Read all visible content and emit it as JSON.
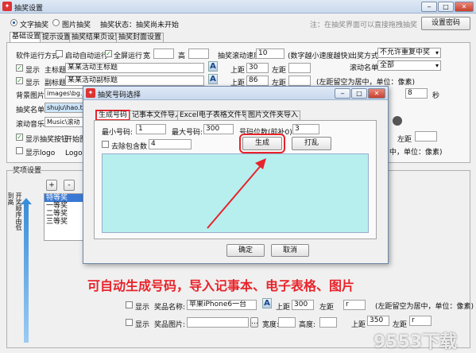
{
  "main": {
    "title": "抽奖设置",
    "mode_text": "文字抽奖",
    "mode_image": "图片抽奖",
    "status_label": "抽奖状态：",
    "status_value": "抽奖尚未开始",
    "hint": "注：在抽奖界面可以直接拖拽抽奖",
    "set_password": "设置密码",
    "tabs": [
      "基础设置",
      "提示设置",
      "抽奖结果页设置",
      "抽奖封面设置"
    ],
    "run_mode_label": "软件运行方式",
    "auto_start": "启动自动运行",
    "fullscreen": "全屏运行",
    "width_label": "宽",
    "height_label": "高",
    "show": "显示",
    "main_title_label": "主标题",
    "main_title_value": "某某活动主标题",
    "sub_title_label": "副标题",
    "sub_title_value": "某某活动副标题",
    "speed_label": "抽奖滚动速度",
    "speed_value": "10",
    "speed_note": "(数字越小速度越快)",
    "prize_mode_label": "出奖方式",
    "prize_mode_value": "不允许重复中奖",
    "roll_list_label": "滚动名单",
    "roll_list_value": "全部",
    "top_label": "上距",
    "left_label": "左距",
    "top1": "30",
    "top2": "86",
    "center_note": "(左距留空为居中，单位：像素)",
    "bg_label": "背景图片",
    "bg_value": "images\\bg.jpg",
    "list_label": "抽奖名单",
    "list_value": "shuju\\hao.txt",
    "music_label": "滚动音乐",
    "music_value": "Music\\滚动音乐",
    "spin_value": "8",
    "sec_label": "秒",
    "show_btn": "显示抽奖按钮",
    "start_pic": "开始图片",
    "show_logo": "显示logo",
    "logo_pic": "Logo图片",
    "center_note2": "中，单位：像素)",
    "prize_settings": "奖项设置",
    "plus": "+",
    "minus": "-",
    "order_label": "开奖顺序由低到高",
    "prizes": [
      "特等奖",
      "一等奖",
      "二等奖",
      "三等奖"
    ],
    "prize_name_label": "奖品名称:",
    "prize_name_value": "苹果iPhone6一台",
    "top3": "300",
    "left3": "r",
    "prize_pic_label": "奖品图片:",
    "width2": "宽度:",
    "height2": "高度:",
    "top4": "350",
    "left4": "r",
    "center_note3": "(左距留空为居中，单位：像素)",
    "banner": "可自动生成号码，导入记事本、电子表格、图片",
    "watermark": "9553下载"
  },
  "dialog": {
    "title": "抽奖号码选择",
    "tabs": [
      "生成号码",
      "记事本文件导入",
      "Excel电子表格文件导入",
      "图片文件夹导入"
    ],
    "min_label": "最小号码:",
    "min_value": "1",
    "max_label": "最大号码:",
    "max_value": "300",
    "digits_label": "号码位数(前补0):",
    "digits_value": "3",
    "exclude_label": "去除包含数",
    "exclude_value": "4",
    "generate": "生成",
    "shuffle": "打乱",
    "ok": "确定",
    "cancel": "取消"
  },
  "colors": {
    "accent": "#e8232a",
    "banner_text": "#e8232a",
    "list_bg": "#b7efef",
    "arrow": "#e8232a"
  }
}
